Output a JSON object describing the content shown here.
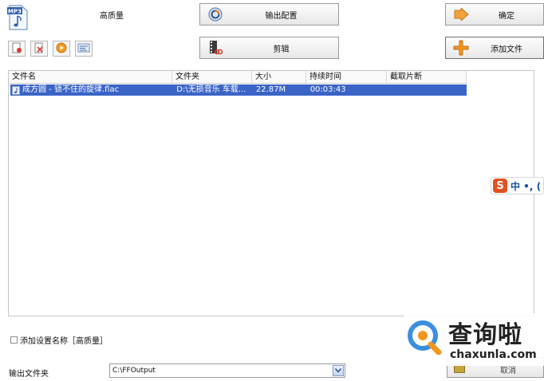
{
  "app": {
    "quality_label": "高质量",
    "icon_badge": "MP3"
  },
  "toolbar": {
    "output_config_label": "输出配置",
    "cut_label": "剪辑",
    "ok_label": "确定",
    "add_file_label": "添加文件"
  },
  "file_list": {
    "columns": [
      "文件名",
      "文件夹",
      "大小",
      "持续时间",
      "截取片断"
    ],
    "rows": [
      {
        "name": "成方圆 - 锁不住的旋律.flac",
        "folder": "D:\\无损音乐 车载...",
        "size": "22.87M",
        "duration": "00:03:43",
        "clip": ""
      }
    ]
  },
  "ime": {
    "logo": "S",
    "text": "中 •, ("
  },
  "bottom": {
    "add_setting_label": "添加设置名称［高质量］",
    "output_folder_label": "输出文件夹",
    "output_folder_value": "C:\\FFOutput",
    "cancel_partial_label": "取消"
  },
  "watermark": {
    "cn": "查询啦",
    "en": "chaxunla.com"
  }
}
